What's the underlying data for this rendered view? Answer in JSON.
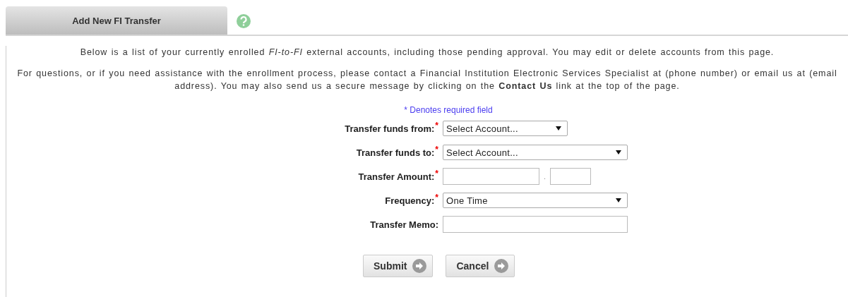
{
  "tabs": [
    {
      "label": "Add New FI Transfer",
      "selected": true
    }
  ],
  "intro": [
    "Below is a list of your currently enrolled *FI-to-FI* external accounts, including those pending approval. You may edit or delete accounts from this page.",
    "For questions, or if you need assistance with the enrollment process, please contact a Financial Institution Electronic Services Specialist at (phone number) or email us at (email address). You may also send us a secure message by clicking on the **Contact Us** link at the top of the page."
  ],
  "required_note": "* Denotes required field",
  "fields": [
    {
      "kind": "short_select",
      "label": "Transfer funds from:",
      "required_mark": "*",
      "value": "Select Account..."
    },
    {
      "kind": "select",
      "label": "Transfer funds to:",
      "required_mark": "*",
      "value": "Select Account..."
    },
    {
      "kind": "amount",
      "label": "Transfer Amount:",
      "required_mark": "*",
      "separator": "."
    },
    {
      "kind": "select",
      "label": "Frequency:",
      "required_mark": "*",
      "value": "One Time"
    },
    {
      "kind": "text",
      "label": "Transfer Memo:"
    }
  ],
  "buttons": [
    "Submit",
    "Cancel"
  ]
}
